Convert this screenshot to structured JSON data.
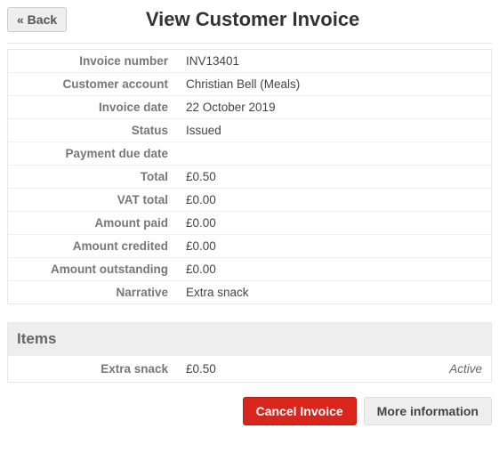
{
  "header": {
    "back_label": "« Back",
    "title": "View Customer Invoice"
  },
  "details": {
    "rows": [
      {
        "label": "Invoice number",
        "value": "INV13401"
      },
      {
        "label": "Customer account",
        "value": "Christian Bell (Meals)"
      },
      {
        "label": "Invoice date",
        "value": "22 October 2019"
      },
      {
        "label": "Status",
        "value": "Issued"
      },
      {
        "label": "Payment due date",
        "value": ""
      },
      {
        "label": "Total",
        "value": "£0.50"
      },
      {
        "label": "VAT total",
        "value": "£0.00"
      },
      {
        "label": "Amount paid",
        "value": "£0.00"
      },
      {
        "label": "Amount credited",
        "value": "£0.00"
      },
      {
        "label": "Amount outstanding",
        "value": "£0.00"
      },
      {
        "label": "Narrative",
        "value": "Extra snack"
      }
    ]
  },
  "items": {
    "heading": "Items",
    "rows": [
      {
        "label": "Extra snack",
        "value": "£0.50",
        "status": "Active"
      }
    ]
  },
  "actions": {
    "cancel_label": "Cancel Invoice",
    "more_label": "More information"
  }
}
